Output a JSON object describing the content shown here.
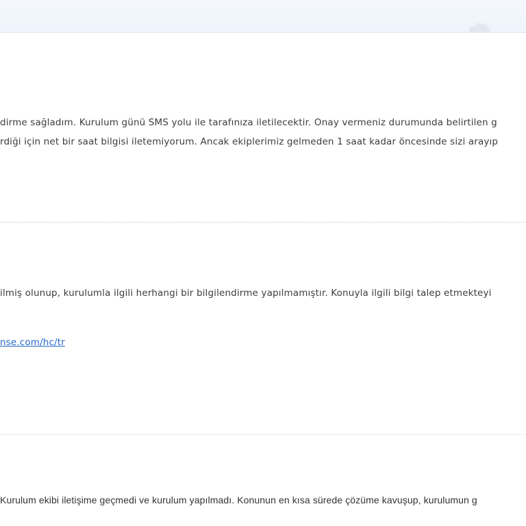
{
  "colors": {
    "header_background": "#eef4fb",
    "link": "#2468c8",
    "text": "#3c3c3c"
  },
  "header": {
    "icon": "cloud-icon"
  },
  "messages": [
    {
      "lines": [
        "dirme sağladım. Kurulum günü SMS yolu ile tarafınıza iletilecektir. Onay vermeniz durumunda belirtilen g",
        "rdiği için net bir saat bilgisi iletemiyorum. Ancak ekiplerimiz gelmeden 1 saat kadar öncesinde sizi arayıp"
      ]
    },
    {
      "lines": [
        "ilmiş olunup, kurulumla ilgili herhangi bir bilgilendirme yapılmamıştır. Konuyla ilgili bilgi talep etmekteyi"
      ],
      "link_text": "nse.com/hc/tr"
    },
    {
      "lines": [
        "Kurulum ekibi iletişime geçmedi ve kurulum yapılmadı. Konunun en kısa sürede çözüme kavuşup, kurulumun g"
      ]
    }
  ]
}
